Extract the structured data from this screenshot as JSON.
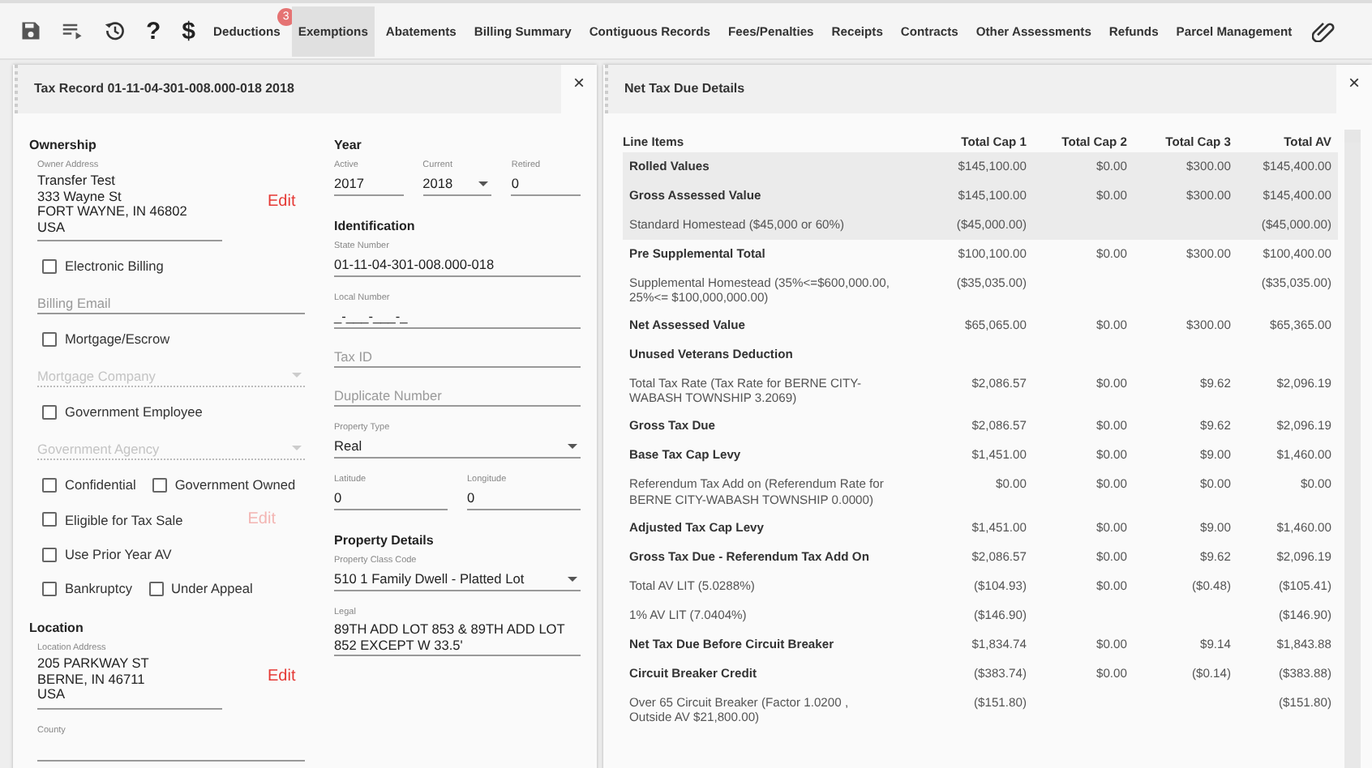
{
  "toolbar": {
    "tools": [
      {
        "kind": "save"
      },
      {
        "kind": "list"
      },
      {
        "kind": "history"
      },
      {
        "kind": "glyph",
        "text": "?"
      },
      {
        "kind": "glyph",
        "text": "$"
      }
    ],
    "tabs": [
      {
        "label": "Deductions",
        "selected": false,
        "badge": "3"
      },
      {
        "label": "Exemptions",
        "selected": true
      },
      {
        "label": "Abatements",
        "selected": false
      },
      {
        "label": "Billing Summary",
        "selected": false
      },
      {
        "label": "Contiguous Records",
        "selected": false
      },
      {
        "label": "Fees/Penalties",
        "selected": false
      },
      {
        "label": "Receipts",
        "selected": false
      },
      {
        "label": "Contracts",
        "selected": false
      },
      {
        "label": "Other Assessments",
        "selected": false
      },
      {
        "label": "Refunds",
        "selected": false
      },
      {
        "label": "Parcel Management",
        "selected": false
      }
    ],
    "trailing_tools": [
      {
        "kind": "paperclip"
      }
    ]
  },
  "tax_record": {
    "title": "Tax Record 01-11-04-301-008.000-018 2018",
    "close": "×",
    "left_column": [
      {
        "kind": "heading",
        "text": "Ownership"
      },
      {
        "kind": "address",
        "label": "Owner Address",
        "lines": [
          "Transfer Test",
          "333 Wayne St",
          "FORT WAYNE, IN 46802",
          "USA"
        ],
        "action": {
          "text": "Edit",
          "disabled": false
        }
      },
      {
        "kind": "checks",
        "boxes": [
          {
            "label": "Electronic Billing",
            "checked": false
          }
        ]
      },
      {
        "kind": "field",
        "placeholder": "Billing Email",
        "disabled": false
      },
      {
        "kind": "checks",
        "boxes": [
          {
            "label": "Mortgage/Escrow",
            "checked": false
          }
        ]
      },
      {
        "kind": "select",
        "placeholder": "Mortgage Company",
        "disabled": true
      },
      {
        "kind": "checks",
        "boxes": [
          {
            "label": "Government Employee",
            "checked": false
          }
        ]
      },
      {
        "kind": "select",
        "placeholder": "Government Agency",
        "disabled": true
      },
      {
        "kind": "checks",
        "boxes": [
          {
            "label": "Confidential",
            "checked": false
          },
          {
            "label": "Government Owned",
            "checked": false
          }
        ]
      },
      {
        "kind": "checks",
        "boxes": [
          {
            "label": "Eligible for Tax Sale",
            "checked": false
          }
        ],
        "action": {
          "text": "Edit",
          "disabled": true
        }
      },
      {
        "kind": "checks",
        "boxes": [
          {
            "label": "Use Prior Year AV",
            "checked": false
          }
        ]
      },
      {
        "kind": "checks",
        "boxes": [
          {
            "label": "Bankruptcy",
            "checked": false
          },
          {
            "label": "Under Appeal",
            "checked": false
          }
        ]
      },
      {
        "kind": "heading",
        "text": "Location"
      },
      {
        "kind": "address",
        "label": "Location Address",
        "lines": [
          "205 PARKWAY ST",
          "BERNE, IN 46711",
          "USA"
        ],
        "action": {
          "text": "Edit",
          "disabled": false
        }
      },
      {
        "kind": "field",
        "label": "County",
        "disabled": false
      }
    ],
    "right_column": [
      {
        "kind": "heading",
        "text": "Year"
      },
      {
        "kind": "row",
        "fields": [
          {
            "kind": "field",
            "label": "Active",
            "value": "2017",
            "disabled": false
          },
          {
            "kind": "select",
            "label": "Current",
            "value": "2018",
            "disabled": false
          },
          {
            "kind": "field",
            "label": "Retired",
            "value": "0",
            "disabled": false
          }
        ]
      },
      {
        "kind": "heading",
        "text": "Identification"
      },
      {
        "kind": "field",
        "label": "State Number",
        "value": "01-11-04-301-008.000-018",
        "disabled": false
      },
      {
        "kind": "field",
        "label": "Local Number",
        "value": "_-___-___-_",
        "disabled": false
      },
      {
        "kind": "field",
        "placeholder": "Tax ID",
        "disabled": false
      },
      {
        "kind": "field",
        "placeholder": "Duplicate Number",
        "disabled": false
      },
      {
        "kind": "select",
        "label": "Property Type",
        "value": "Real",
        "disabled": false
      },
      {
        "kind": "row",
        "fields": [
          {
            "kind": "field",
            "label": "Latitude",
            "value": "0",
            "disabled": false
          },
          {
            "kind": "field",
            "label": "Longitude",
            "value": "0",
            "disabled": false
          }
        ]
      },
      {
        "kind": "heading",
        "text": "Property Details"
      },
      {
        "kind": "select",
        "label": "Property Class Code",
        "value": "510 1 Family Dwell - Platted Lot",
        "disabled": false
      },
      {
        "kind": "field",
        "label": "Legal",
        "value": "89TH ADD LOT 853 & 89TH ADD LOT 852 EXCEPT W 33.5'",
        "disabled": false
      }
    ]
  },
  "net_tax": {
    "title": "Net Tax Due Details",
    "close": "×",
    "columns": [
      "Line Items",
      "Total Cap 1",
      "Total Cap 2",
      "Total Cap 3",
      "Total AV"
    ],
    "rows": [
      {
        "label": "Rolled Values",
        "bold": true,
        "highlighted": true,
        "cap1": "$145,100.00",
        "cap2": "$0.00",
        "cap3": "$300.00",
        "av": "$145,400.00"
      },
      {
        "label": "Gross Assessed Value",
        "bold": true,
        "highlighted": true,
        "cap1": "$145,100.00",
        "cap2": "$0.00",
        "cap3": "$300.00",
        "av": "$145,400.00"
      },
      {
        "label": "Standard Homestead ($45,000 or 60%)",
        "bold": false,
        "highlighted": true,
        "cap1": "($45,000.00)",
        "av": "($45,000.00)"
      },
      {
        "label": "Pre Supplemental Total",
        "bold": true,
        "highlighted": false,
        "cap1": "$100,100.00",
        "cap2": "$0.00",
        "cap3": "$300.00",
        "av": "$100,400.00"
      },
      {
        "label": "Supplemental Homestead (35%<=$600,000.00, 25%<= $100,000,000.00)",
        "bold": false,
        "highlighted": false,
        "cap1": "($35,035.00)",
        "av": "($35,035.00)"
      },
      {
        "label": "Net Assessed Value",
        "bold": true,
        "highlighted": false,
        "cap1": "$65,065.00",
        "cap2": "$0.00",
        "cap3": "$300.00",
        "av": "$65,365.00"
      },
      {
        "label": "Unused Veterans Deduction",
        "bold": true,
        "highlighted": false
      },
      {
        "label": "Total Tax Rate (Tax Rate for BERNE CITY-WABASH TOWNSHIP 3.2069)",
        "bold": false,
        "highlighted": false,
        "cap1": "$2,086.57",
        "cap2": "$0.00",
        "cap3": "$9.62",
        "av": "$2,096.19"
      },
      {
        "label": "Gross Tax Due",
        "bold": true,
        "highlighted": false,
        "cap1": "$2,086.57",
        "cap2": "$0.00",
        "cap3": "$9.62",
        "av": "$2,096.19"
      },
      {
        "label": "Base Tax Cap Levy",
        "bold": true,
        "highlighted": false,
        "cap1": "$1,451.00",
        "cap2": "$0.00",
        "cap3": "$9.00",
        "av": "$1,460.00"
      },
      {
        "label": "Referendum Tax Add on (Referendum Rate for BERNE CITY-WABASH TOWNSHIP 0.0000)",
        "bold": false,
        "highlighted": false,
        "cap1": "$0.00",
        "cap2": "$0.00",
        "cap3": "$0.00",
        "av": "$0.00"
      },
      {
        "label": "Adjusted Tax Cap Levy",
        "bold": true,
        "highlighted": false,
        "cap1": "$1,451.00",
        "cap2": "$0.00",
        "cap3": "$9.00",
        "av": "$1,460.00"
      },
      {
        "label": "Gross Tax Due - Referendum Tax Add On",
        "bold": true,
        "highlighted": false,
        "cap1": "$2,086.57",
        "cap2": "$0.00",
        "cap3": "$9.62",
        "av": "$2,096.19"
      },
      {
        "label": "Total AV LIT (5.0288%)",
        "bold": false,
        "highlighted": false,
        "cap1": "($104.93)",
        "cap2": "$0.00",
        "cap3": "($0.48)",
        "av": "($105.41)"
      },
      {
        "label": "1% AV LIT (7.0404%)",
        "bold": false,
        "highlighted": false,
        "cap1": "($146.90)",
        "av": "($146.90)"
      },
      {
        "label": "Net Tax Due Before Circuit Breaker",
        "bold": true,
        "highlighted": false,
        "cap1": "$1,834.74",
        "cap2": "$0.00",
        "cap3": "$9.14",
        "av": "$1,843.88"
      },
      {
        "label": "Circuit Breaker Credit",
        "bold": true,
        "highlighted": false,
        "cap1": "($383.74)",
        "cap2": "$0.00",
        "cap3": "($0.14)",
        "av": "($383.88)"
      },
      {
        "label": "Over 65 Circuit Breaker (Factor 1.0200 , Outside AV $21,800.00)",
        "bold": false,
        "highlighted": false,
        "cap1": "($151.80)",
        "av": "($151.80)"
      }
    ]
  }
}
